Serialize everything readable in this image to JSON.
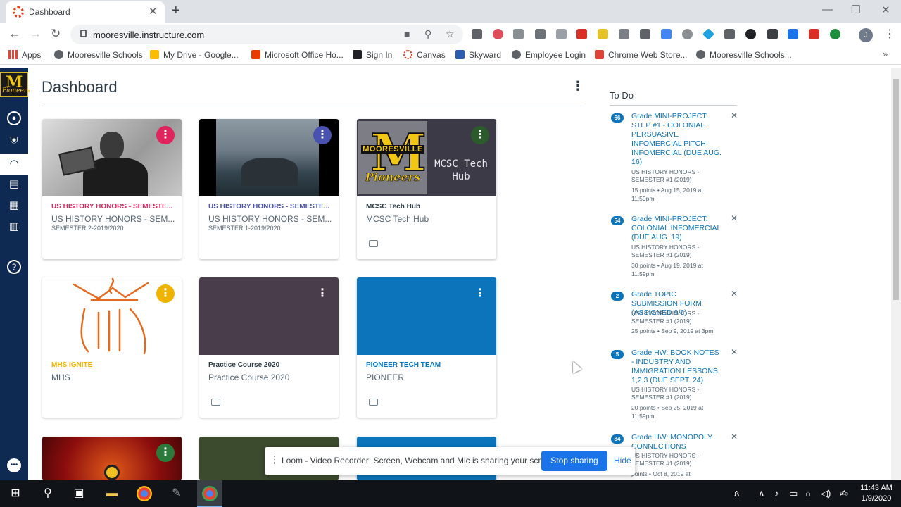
{
  "browser": {
    "tab_title": "Dashboard",
    "url": "mooresville.instructure.com",
    "profile_initial": "J",
    "bookmarks": [
      "Apps",
      "Mooresville Schools",
      "My Drive - Google...",
      "Microsoft Office Ho...",
      "Sign In",
      "Canvas",
      "Skyward",
      "Employee Login",
      "Chrome Web Store...",
      "Mooresville Schools..."
    ]
  },
  "colors": {
    "canvas_nav": "#0e2a52",
    "link_blue": "#0b74bb",
    "card_pink": "#e0245e",
    "card_indigo": "#4a52b0",
    "card_green": "#2b5a2b",
    "card_yellow": "#f0b400",
    "card_plum": "#4a3d4b",
    "card_blue": "#0b74bb"
  },
  "page": {
    "title": "Dashboard"
  },
  "cards": [
    {
      "code": "US HISTORY HONORS - SEMESTE...",
      "name": "US HISTORY HONORS - SEM...",
      "term": "SEMESTER 2-2019/2020",
      "accent": "#e0245e"
    },
    {
      "code": "US HISTORY HONORS - SEMESTE...",
      "name": "US HISTORY HONORS - SEM...",
      "term": "SEMESTER 1-2019/2020",
      "accent": "#4a52b0"
    },
    {
      "code": "MCSC Tech Hub",
      "name": "MCSC Tech Hub",
      "term": "",
      "accent": "#2d3b45",
      "hero_text": "MCSC Tech Hub",
      "logo_word": "MOORESVILLE",
      "logo_script": "Pioneers"
    },
    {
      "code": "MHS IGNITE",
      "name": "MHS",
      "term": "",
      "accent": "#f0b400"
    },
    {
      "code": "Practice Course 2020",
      "name": "Practice Course 2020",
      "term": "",
      "accent": "#2d3b45"
    },
    {
      "code": "PIONEER TECH TEAM",
      "name": "PIONEER",
      "term": "",
      "accent": "#0b74bb"
    }
  ],
  "todo": {
    "heading": "To Do",
    "items": [
      {
        "count": "66",
        "title": "Grade MINI-PROJECT: STEP #1 - COLONIAL PERSUASIVE INFOMERCIAL PITCH INFOMERCIAL (DUE AUG. 16)",
        "course": "US HISTORY HONORS - SEMESTER #1 (2019)",
        "meta": "15 points • Aug 15, 2019 at 11:59pm"
      },
      {
        "count": "54",
        "title": "Grade MINI-PROJECT: COLONIAL INFOMERCIAL (DUE AUG. 19)",
        "course": "US HISTORY HONORS - SEMESTER #1 (2019)",
        "meta": "30 points • Aug 19, 2019 at 11:59pm"
      },
      {
        "count": "2",
        "title": "Grade TOPIC SUBMISSION FORM (ASSIGNED 9/6)",
        "course": "US HISTORY HONORS - SEMESTER #1 (2019)",
        "meta": "25 points • Sep 9, 2019 at 3pm"
      },
      {
        "count": "5",
        "title": "Grade HW: BOOK NOTES - INDUSTRY AND IMMIGRATION LESSONS 1,2,3 (DUE SEPT. 24)",
        "course": "US HISTORY HONORS - SEMESTER #1 (2019)",
        "meta": "20 points • Sep 25, 2019 at 11:59pm"
      },
      {
        "count": "84",
        "title": "Grade HW: MONOPOLY CONNECTIONS",
        "course": "US HISTORY HONORS - SEMESTER #1 (2019)",
        "meta": "points • Oct 8, 2019 at"
      }
    ]
  },
  "loom": {
    "message": "Loom - Video Recorder: Screen, Webcam and Mic is sharing your screen.",
    "stop_label": "Stop sharing",
    "hide_label": "Hide"
  },
  "taskbar": {
    "time": "11:43 AM",
    "date": "1/9/2020"
  }
}
